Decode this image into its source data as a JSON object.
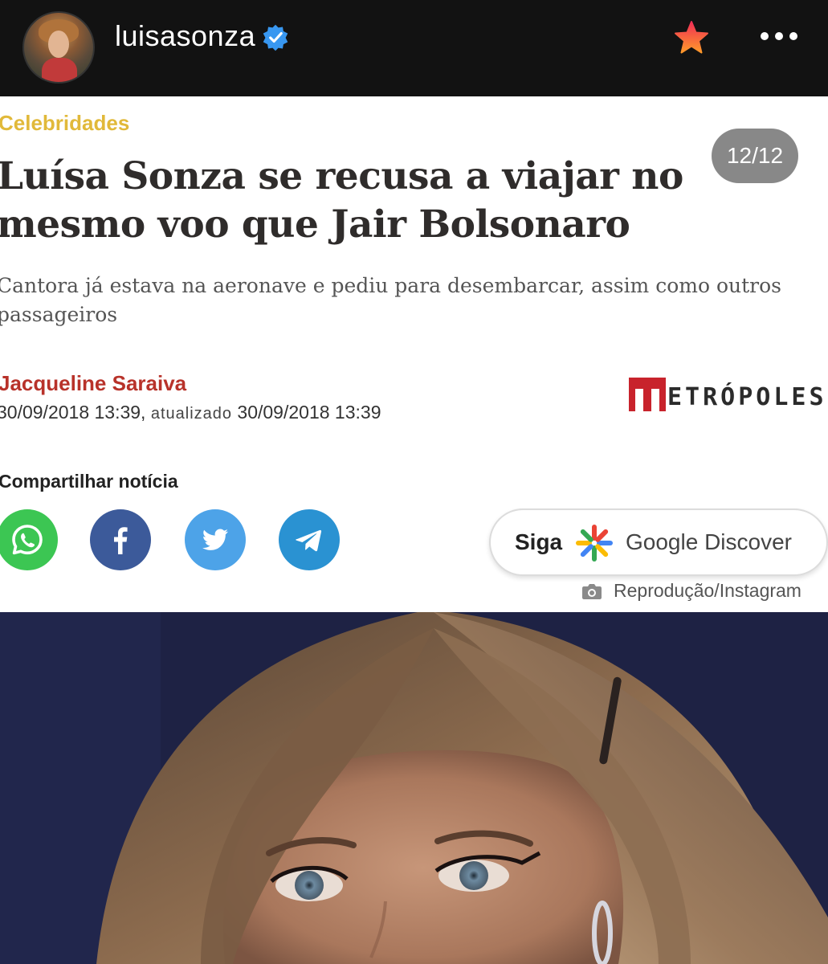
{
  "instagram": {
    "username": "luisasonza",
    "verified": true,
    "accent_star_color": "#f0523a",
    "verified_color": "#3897f0"
  },
  "article": {
    "category": "Celebridades",
    "headline": "Luísa Sonza se recusa a viajar no mesmo voo que Jair Bolsonaro",
    "subtitle": "Cantora já estava na aeronave e pediu para desembarcar, assim como outros passageiros",
    "author": "Jacqueline Saraiva",
    "published": "30/09/2018 13:39,",
    "updated_label": "atualizado",
    "updated": "30/09/2018 13:39",
    "publisher_logo_letter": "M",
    "publisher_logo_rest": "ETRÓPOLES",
    "share_label": "Compartilhar notícia",
    "share_buttons": [
      {
        "network": "whatsapp",
        "icon": "whatsapp-icon",
        "color": "#3cc653"
      },
      {
        "network": "facebook",
        "icon": "facebook-icon",
        "color": "#3c5a9a"
      },
      {
        "network": "twitter",
        "icon": "twitter-icon",
        "color": "#4da3e8"
      },
      {
        "network": "telegram",
        "icon": "telegram-icon",
        "color": "#2a92d2"
      }
    ],
    "discover_follow": "Siga",
    "discover_label": "Google Discover",
    "photo_credit": "Reprodução/Instagram"
  },
  "carousel": {
    "counter": "12/12"
  },
  "colors": {
    "category": "#e1b93a",
    "author": "#b8322a",
    "headline": "#2f2c2b"
  }
}
